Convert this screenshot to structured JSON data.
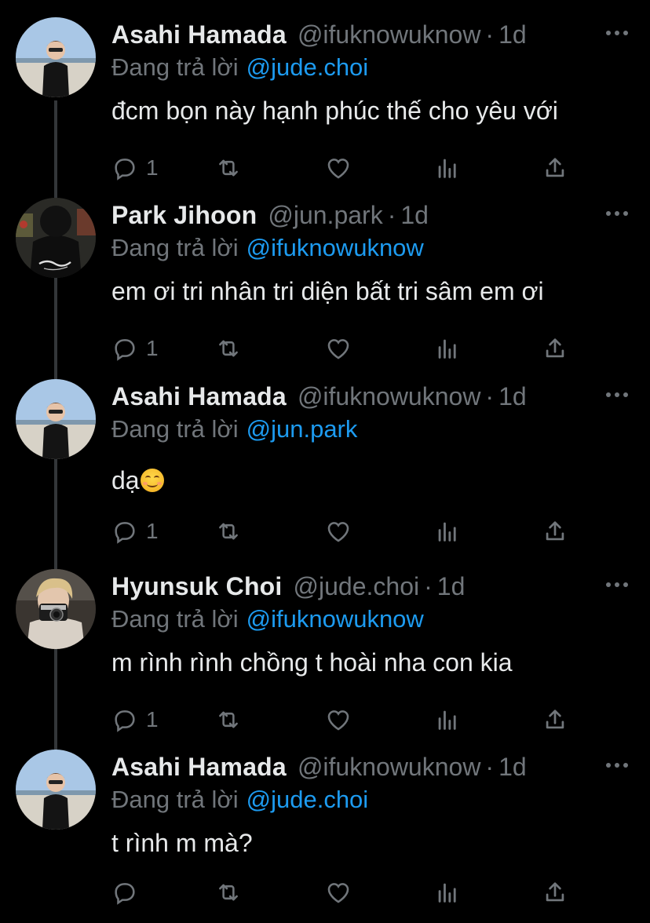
{
  "thread": [
    {
      "name": "Asahi Hamada",
      "handle": "@ifuknowuknow",
      "time": "1d",
      "reply_prefix": "Đang trả lời",
      "reply_to": "@jude.choi",
      "text": "đcm bọn này hạnh phúc thế cho yêu với",
      "reply_count": "1",
      "avatar": "asahi-avatar"
    },
    {
      "name": "Park Jihoon",
      "handle": "@jun.park",
      "time": "1d",
      "reply_prefix": "Đang trả lời",
      "reply_to": "@ifuknowuknow",
      "text": "em ơi tri nhân tri diện bất tri sâm em ơi",
      "reply_count": "1",
      "avatar": "jihoon-avatar"
    },
    {
      "name": "Asahi Hamada",
      "handle": "@ifuknowuknow",
      "time": "1d",
      "reply_prefix": "Đang trả lời",
      "reply_to": "@jun.park",
      "text": "dạ",
      "emoji": "smiling-face-emoji",
      "reply_count": "1",
      "avatar": "asahi-avatar"
    },
    {
      "name": "Hyunsuk Choi",
      "handle": "@jude.choi",
      "time": "1d",
      "reply_prefix": "Đang trả lời",
      "reply_to": "@ifuknowuknow",
      "text": "m rình rình chồng t hoài nha con kia",
      "reply_count": "1",
      "avatar": "hyunsuk-avatar"
    },
    {
      "name": "Asahi Hamada",
      "handle": "@ifuknowuknow",
      "time": "1d",
      "reply_prefix": "Đang trả lời",
      "reply_to": "@jude.choi",
      "text": "t rình m mà?",
      "reply_count": "",
      "avatar": "asahi-avatar"
    }
  ],
  "icons": [
    "reply-icon",
    "retweet-icon",
    "like-icon",
    "analytics-icon",
    "share-icon",
    "more-icon"
  ],
  "colors": {
    "background": "#000000",
    "text": "#e7e9ea",
    "muted": "#71767b",
    "link": "#1d9bf0",
    "thread_line": "#333639"
  },
  "separator": "·"
}
